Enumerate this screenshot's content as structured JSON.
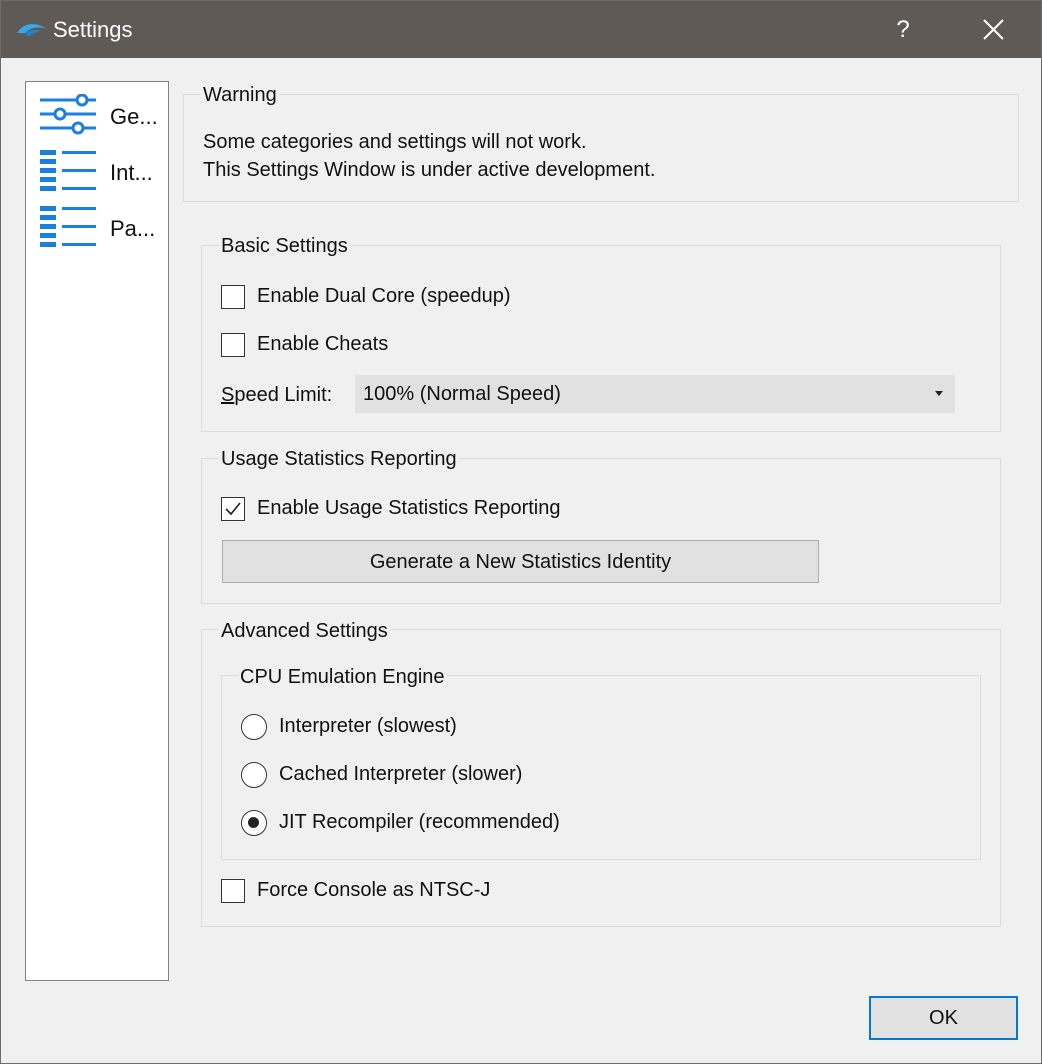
{
  "window": {
    "title": "Settings",
    "help_label": "?"
  },
  "sidebar": {
    "items": [
      {
        "label": "Ge...",
        "icon": "sliders-icon"
      },
      {
        "label": "Int...",
        "icon": "list-icon"
      },
      {
        "label": "Pa...",
        "icon": "list-icon"
      }
    ]
  },
  "warning": {
    "title": "Warning",
    "line1": "Some categories and settings will not work.",
    "line2": "This Settings Window is under active development."
  },
  "basic": {
    "title": "Basic Settings",
    "dual_core": {
      "label": "Enable Dual Core (speedup)",
      "checked": false
    },
    "cheats": {
      "label": "Enable Cheats",
      "checked": false
    },
    "speed_limit": {
      "label_mnemonic": "S",
      "label_rest": "peed Limit:",
      "value": "100% (Normal Speed)"
    }
  },
  "usage": {
    "title": "Usage Statistics Reporting",
    "enable": {
      "label": "Enable Usage Statistics Reporting",
      "checked": true
    },
    "generate_button": "Generate a New Statistics Identity"
  },
  "advanced": {
    "title": "Advanced Settings",
    "cpu": {
      "title": "CPU Emulation Engine",
      "options": [
        {
          "label": "Interpreter (slowest)",
          "selected": false
        },
        {
          "label": "Cached Interpreter (slower)",
          "selected": false
        },
        {
          "label": "JIT Recompiler (recommended)",
          "selected": true
        }
      ]
    },
    "ntsc": {
      "label": "Force Console as NTSC-J",
      "checked": false
    }
  },
  "footer": {
    "ok_label": "OK"
  },
  "colors": {
    "titlebar": "#5f5a55",
    "accent": "#1a7fe0",
    "focus_border": "#0078d7"
  }
}
